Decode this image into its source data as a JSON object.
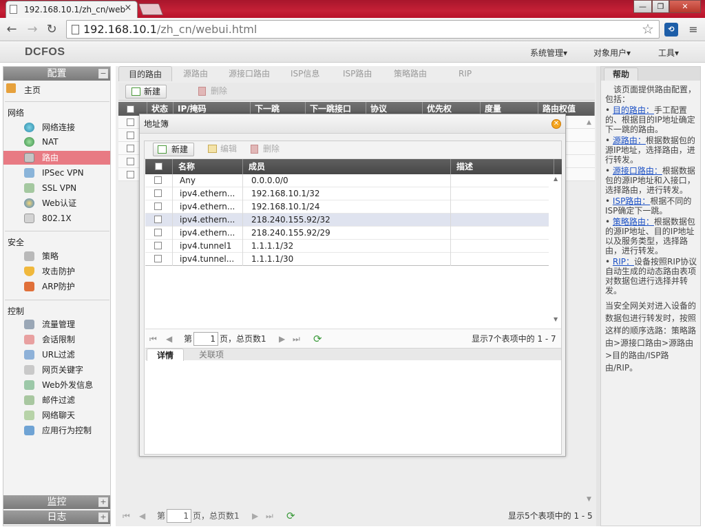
{
  "browser": {
    "tab_title": "192.168.10.1/zh_cn/web",
    "tab_close": "×",
    "window_buttons": [
      "—",
      "❐",
      "✕"
    ],
    "url_host": "192.168.10.1",
    "url_path": "/zh_cn/webui.html"
  },
  "app": {
    "logo": "DCFOS",
    "top_menu": [
      "系统管理▾",
      "对象用户▾",
      "工具▾"
    ]
  },
  "sidebar": {
    "config_title": "配置",
    "home": "主页",
    "section_network": "网络",
    "network_items": [
      "网络连接",
      "NAT",
      "路由",
      "IPSec VPN",
      "SSL VPN",
      "Web认证",
      "802.1X"
    ],
    "section_security": "安全",
    "security_items": [
      "策略",
      "攻击防护",
      "ARP防护"
    ],
    "section_control": "控制",
    "control_items": [
      "流量管理",
      "会话限制",
      "URL过滤",
      "网页关键字",
      "Web外发信息",
      "邮件过滤",
      "网络聊天",
      "应用行为控制"
    ],
    "monitor_title": "监控",
    "log_title": "日志"
  },
  "main": {
    "tabs": [
      "目的路由",
      "源路由",
      "源接口路由",
      "ISP信息",
      "ISP路由",
      "策略路由",
      "RIP"
    ],
    "toolbar": {
      "new": "新建",
      "delete": "删除"
    },
    "columns": [
      "状态",
      "IP/掩码",
      "下一跳",
      "下一跳接口",
      "协议",
      "优先权",
      "度量",
      "路由权值"
    ],
    "pager": {
      "page_prefix": "第",
      "page": "1",
      "page_suffix": "页，总页数1",
      "summary": "显示5个表项中的 1 - 5"
    }
  },
  "dialog": {
    "title": "地址簿",
    "toolbar": {
      "new": "新建",
      "edit": "编辑",
      "delete": "删除"
    },
    "columns": [
      "名称",
      "成员",
      "描述"
    ],
    "rows": [
      {
        "name": "Any",
        "member": "0.0.0.0/0",
        "desc": ""
      },
      {
        "name": "ipv4.ethern...",
        "member": "192.168.10.1/32",
        "desc": ""
      },
      {
        "name": "ipv4.ethern...",
        "member": "192.168.10.1/24",
        "desc": ""
      },
      {
        "name": "ipv4.ethern...",
        "member": "218.240.155.92/32",
        "desc": ""
      },
      {
        "name": "ipv4.ethern...",
        "member": "218.240.155.92/29",
        "desc": ""
      },
      {
        "name": "ipv4.tunnel1",
        "member": "1.1.1.1/32",
        "desc": ""
      },
      {
        "name": "ipv4.tunnel...",
        "member": "1.1.1.1/30",
        "desc": ""
      }
    ],
    "pager": {
      "page_prefix": "第",
      "page": "1",
      "page_suffix": "页，总页数1",
      "summary": "显示7个表项中的 1 - 7"
    },
    "subtabs": [
      "详情",
      "关联项"
    ]
  },
  "help": {
    "title": "帮助",
    "intro": "该页面提供路由配置，包括：",
    "items": [
      {
        "link": "目的路由：",
        "text": "手工配置的、根据目的IP地址确定下一跳的路由。"
      },
      {
        "link": "源路由：",
        "text": "根据数据包的源IP地址，选择路由，进行转发。"
      },
      {
        "link": "源接口路由：",
        "text": "根据数据包的源IP地址和入接口，选择路由，进行转发。"
      },
      {
        "link": "ISP路由：",
        "text": "根据不同的ISP确定下一跳。"
      },
      {
        "link": "策略路由：",
        "text": "根据数据包的源IP地址、目的IP地址以及服务类型，选择路由，进行转发。"
      },
      {
        "link": "RIP：",
        "text": "设备按照RIP协议自动生成的动态路由表项对数据包进行选择并转发。"
      }
    ],
    "footer": "当安全网关对进入设备的数据包进行转发时，按照这样的顺序选路：策略路由>源接口路由>源路由>目的路由/ISP路由/RIP。"
  }
}
